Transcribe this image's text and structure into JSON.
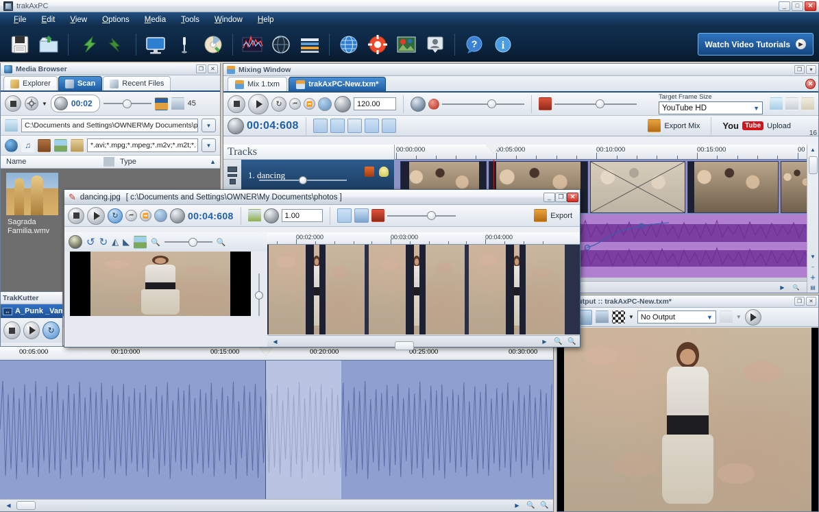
{
  "window": {
    "title": "trakAxPC",
    "icon": "app-icon",
    "buttons": {
      "minimize": "_",
      "maximize": "□",
      "close": "✕"
    }
  },
  "menubar": {
    "items": [
      {
        "label": "File",
        "accel": "F"
      },
      {
        "label": "Edit",
        "accel": "E"
      },
      {
        "label": "View",
        "accel": "V"
      },
      {
        "label": "Options",
        "accel": "O"
      },
      {
        "label": "Media",
        "accel": "M"
      },
      {
        "label": "Tools",
        "accel": "T"
      },
      {
        "label": "Window",
        "accel": "W"
      },
      {
        "label": "Help",
        "accel": "H"
      }
    ]
  },
  "toolbar": {
    "icons": [
      "save-icon",
      "open-folder-icon",
      "import-arrow-icon",
      "export-arrow-icon",
      "monitor-icon",
      "microphone-icon",
      "cd-burn-icon",
      "waveform-editor-icon",
      "globe-sphere-icon",
      "mixer-list-icon",
      "internet-icon",
      "lifering-help-icon",
      "photo-tools-icon",
      "user-profile-icon",
      "help-question-icon",
      "info-icon"
    ],
    "tutorials_button": {
      "label": "Watch Video Tutorials",
      "play_glyph": "▶"
    }
  },
  "media_browser": {
    "title": "Media Browser",
    "icon": "media-browser-icon",
    "header_buttons": {
      "restore": "❐",
      "close": "✕"
    },
    "tabs": [
      {
        "label": "Explorer",
        "icon": "explorer-icon",
        "active": false
      },
      {
        "label": "Scan",
        "icon": "scan-icon",
        "active": true
      },
      {
        "label": "Recent Files",
        "icon": "recent-files-icon",
        "active": false
      }
    ],
    "transport": {
      "stop_icon": "stop-icon",
      "settings_icon": "gear-icon",
      "dropdown_icon": "chevron-down-icon",
      "jog_icon": "jog-dial-icon",
      "time": "00:02",
      "volume_slider_pct": 45,
      "preview_icon": "preview-image-icon",
      "filmstrip_icon": "filmstrip-icon",
      "count": "45"
    },
    "path": {
      "folder_icon": "folder-up-icon",
      "value": "C:\\Documents and Settings\\OWNER\\My Documents\\p",
      "dropdown_icon": "chevron-down-icon"
    },
    "filters": {
      "icons": [
        "all-media-icon",
        "audio-icon",
        "video-icon",
        "image-icon",
        "other-icon"
      ],
      "value": "*.avi;*.mpg;*.mpeg;*.m2v;*.m2t;*.",
      "dropdown_icon": "chevron-down-icon"
    },
    "columns": [
      "Name",
      "Type"
    ],
    "items": [
      {
        "label": "Sagrada Familia.wmv",
        "thumb": "sagrada-familia-thumb"
      }
    ],
    "scroll": {
      "left_arrow": "◀",
      "right_arrow": "▶"
    }
  },
  "trak_kutter": {
    "title": "TrakKutter",
    "icon": "trakkutter-icon",
    "selected_item": "A_Punk _Vam",
    "selected_icon": "audio-clip-icon",
    "buttons": [
      "stop-icon",
      "play-icon",
      "loop-icon"
    ]
  },
  "mixing_window": {
    "title": "Mixing Window",
    "icon": "mixing-window-icon",
    "header_buttons": {
      "restore": "❐",
      "maximize": "▾"
    },
    "close_tab_button": "✕",
    "tabs": [
      {
        "label": "Mix 1.txm",
        "icon": "mix-file-icon",
        "active": false
      },
      {
        "label": "trakAxPC-New.txm*",
        "icon": "mix-file-icon",
        "active": true
      }
    ],
    "transport": {
      "stop_icon": "stop-icon",
      "play_icon": "play-icon",
      "loop_icon": "loop-icon",
      "rewind_start_icon": "skip-back-icon",
      "rewind_icon": "rewind-icon",
      "record_icon": "record-icon",
      "tempo_knob_icon": "tempo-knob-icon",
      "tempo": "120.00"
    },
    "volume": {
      "icon": "volume-icon",
      "mute_icon": "mute-icon",
      "slider_pct": 55
    },
    "fader": {
      "icon": "fader-icon",
      "slider_pct": 50
    },
    "target_frame_size": {
      "label": "Target Frame Size",
      "value": "YouTube HD",
      "dropdown_icon": "chevron-down-icon"
    },
    "right_icons": [
      "upload-icon",
      "copy-icon",
      "paste-icon"
    ],
    "timebar": {
      "jog_icon": "jog-dial-icon",
      "time": "00:04:608",
      "tools": [
        "magic-wand-icon",
        "keyframe-icon",
        "magnet-snap-icon",
        "select-arrow-icon",
        "layers-icon"
      ],
      "export_mix": {
        "label": "Export Mix",
        "icon": "export-mix-icon"
      },
      "youtube_upload": {
        "brand": "You",
        "badge": "Tube",
        "label": "Upload"
      }
    },
    "tracks_header": "Tracks",
    "tracks": [
      {
        "name": "1. dancing",
        "icons": [
          "video-track-icon",
          "mute-track-icon",
          "solo-track-icon"
        ],
        "fader_pct": 46,
        "fx_icons": [
          "effects-icon",
          "lightbulb-icon"
        ]
      }
    ],
    "ruler_labels": [
      "00:00:000",
      "00:05:000",
      "00:10:000",
      "00:15:000",
      "00"
    ],
    "playhead_time": "00:04:608",
    "zoom_buttons": [
      "zoom-out-icon",
      "zoom-in-icon",
      "list-icon"
    ],
    "scroll_icons": [
      "scroll-left-icon",
      "scroll-right-icon"
    ],
    "vscroll": {
      "up": "▲",
      "down": "▼",
      "minus": "−",
      "plus": "+"
    },
    "track_count_badge": "16"
  },
  "dancing_dialog": {
    "title": "dancing.jpg",
    "path": "[ c:\\Documents and Settings\\OWNER\\My Documents\\photos ]",
    "icon": "image-edit-icon",
    "buttons": {
      "minimize": "_",
      "maximize": "❐",
      "close": "✕"
    },
    "transport": {
      "stop_icon": "stop-icon",
      "play_icon": "play-icon",
      "loop_icon": "loop-icon",
      "skip_back_icon": "skip-back-icon",
      "rewind_icon": "rewind-icon",
      "record_icon": "record-icon",
      "jog_icon": "jog-dial-icon",
      "time": "00:04:608"
    },
    "speed": {
      "metronome_icon": "metronome-icon",
      "knob_icon": "speed-knob-icon",
      "value": "1.00"
    },
    "view_buttons": [
      "grid-view-icon",
      "single-view-icon",
      "filmstrip-icon"
    ],
    "zoom_slider_pct": 58,
    "export": {
      "label": "Export",
      "icon": "export-icon"
    },
    "edit_tools": [
      "brightness-icon",
      "rotate-left-icon",
      "rotate-right-icon",
      "flip-vertical-icon",
      "flip-horizontal-icon",
      "crop-icon"
    ],
    "zoom_controls": {
      "out_icon": "zoom-out-icon",
      "in_icon": "zoom-in-icon",
      "slider_pct": 50
    },
    "preview_slider_pct": 50,
    "ruler_labels": [
      "00:02:000",
      "00:03:000",
      "00:04:000"
    ],
    "hscroll": {
      "left": "◀",
      "right": "▶",
      "zoom_out": "zoom-out-icon",
      "zoom_in": "zoom-in-icon"
    }
  },
  "output_panel": {
    "title": "Output :: trakAxPC-New.txm*",
    "icon": "output-icon",
    "header_buttons": {
      "restore": "❐",
      "close": "✕"
    },
    "toolbar_icons": [
      "snapshot-icon",
      "fullscreen-icon",
      "save-frame-icon"
    ],
    "flag_icon": "checkered-flag-icon",
    "flag_dropdown_icon": "chevron-down-icon",
    "output_select": {
      "value": "No Output",
      "dropdown_icon": "chevron-down-icon"
    },
    "meter_icon": "level-meter-icon",
    "meter_dropdown_icon": "chevron-down-icon",
    "play_icon": "play-icon"
  },
  "wave_area": {
    "ruler_labels": [
      "00:05:000",
      "00:10:000",
      "00:15:000",
      "00:20:000",
      "00:25:000",
      "00:30:000"
    ],
    "playhead_label": "00:15:000",
    "scroll": {
      "left": "◀",
      "right": "▶",
      "zoom_out": "zoom-out-icon",
      "zoom_in": "zoom-in-icon"
    }
  },
  "colors": {
    "menu_blue": "#163a61",
    "toolbar_dark": "#0c2541",
    "tab_active": "#1d5da3",
    "accent_blue": "#1f5fa8",
    "track_blue": "#2c5c8e",
    "audio_purple": "#b07fd0",
    "wave_blue": "#8f9fd0",
    "close_red": "#cc2f25"
  }
}
